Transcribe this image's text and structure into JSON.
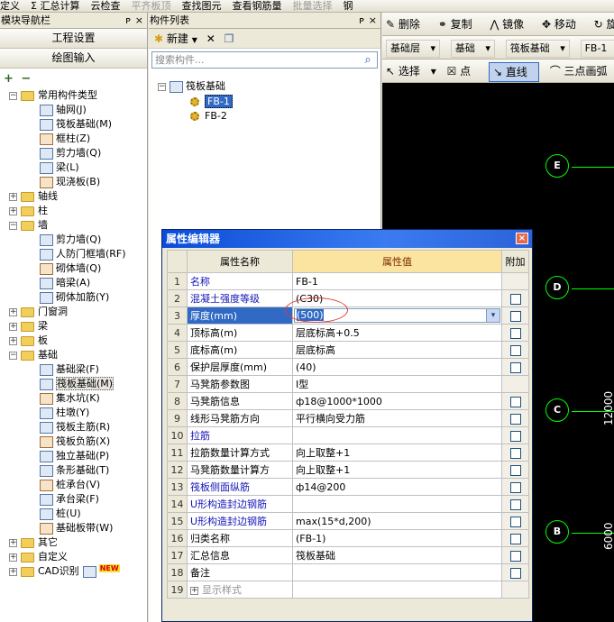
{
  "toolbar": {
    "items": [
      "定义",
      "Σ 汇总计算",
      "云检查",
      "平齐板顶",
      "查找图元",
      "查看钢筋量",
      "批量选择",
      "钢"
    ],
    "disabled": [
      false,
      false,
      false,
      true,
      false,
      false,
      true,
      false
    ]
  },
  "nav": {
    "title": "模块导航栏",
    "pin": "ᴘ",
    "close": "×",
    "btn_project": "工程设置",
    "btn_draw": "绘图输入",
    "tools": "+ −",
    "tree": [
      {
        "label": "常用构件类型",
        "type": "folder",
        "level": 0,
        "exp": "−"
      },
      {
        "label": "轴网(J)",
        "type": "item",
        "level": 1
      },
      {
        "label": "筏板基础(M)",
        "type": "item",
        "level": 1
      },
      {
        "label": "框柱(Z)",
        "type": "item",
        "level": 1
      },
      {
        "label": "剪力墙(Q)",
        "type": "item",
        "level": 1
      },
      {
        "label": "梁(L)",
        "type": "item",
        "level": 1
      },
      {
        "label": "现浇板(B)",
        "type": "item",
        "level": 1
      },
      {
        "label": "轴线",
        "type": "folder",
        "level": 0,
        "exp": "+"
      },
      {
        "label": "柱",
        "type": "folder",
        "level": 0,
        "exp": "+"
      },
      {
        "label": "墙",
        "type": "folder",
        "level": 0,
        "exp": "−"
      },
      {
        "label": "剪力墙(Q)",
        "type": "item",
        "level": 1
      },
      {
        "label": "人防门框墙(RF)",
        "type": "item",
        "level": 1
      },
      {
        "label": "砌体墙(Q)",
        "type": "item",
        "level": 1
      },
      {
        "label": "暗梁(A)",
        "type": "item",
        "level": 1
      },
      {
        "label": "砌体加筋(Y)",
        "type": "item",
        "level": 1
      },
      {
        "label": "门窗洞",
        "type": "folder",
        "level": 0,
        "exp": "+"
      },
      {
        "label": "梁",
        "type": "folder",
        "level": 0,
        "exp": "+"
      },
      {
        "label": "板",
        "type": "folder",
        "level": 0,
        "exp": "+"
      },
      {
        "label": "基础",
        "type": "folder",
        "level": 0,
        "exp": "−"
      },
      {
        "label": "基础梁(F)",
        "type": "item",
        "level": 1
      },
      {
        "label": "筏板基础(M)",
        "type": "item",
        "level": 1,
        "selected": true
      },
      {
        "label": "集水坑(K)",
        "type": "item",
        "level": 1
      },
      {
        "label": "柱墩(Y)",
        "type": "item",
        "level": 1
      },
      {
        "label": "筏板主筋(R)",
        "type": "item",
        "level": 1
      },
      {
        "label": "筏板负筋(X)",
        "type": "item",
        "level": 1
      },
      {
        "label": "独立基础(P)",
        "type": "item",
        "level": 1
      },
      {
        "label": "条形基础(T)",
        "type": "item",
        "level": 1
      },
      {
        "label": "桩承台(V)",
        "type": "item",
        "level": 1
      },
      {
        "label": "承台梁(F)",
        "type": "item",
        "level": 1
      },
      {
        "label": "桩(U)",
        "type": "item",
        "level": 1
      },
      {
        "label": "基础板带(W)",
        "type": "item",
        "level": 1
      },
      {
        "label": "其它",
        "type": "folder",
        "level": 0,
        "exp": "+"
      },
      {
        "label": "自定义",
        "type": "folder",
        "level": 0,
        "exp": "+"
      },
      {
        "label": "CAD识别",
        "type": "folder",
        "level": 0,
        "exp": "+",
        "badge": "NEW"
      }
    ]
  },
  "components": {
    "title": "构件列表",
    "pin": "ᴘ",
    "close": "×",
    "new_label": "新建",
    "delete_icon": "✕",
    "search_placeholder": "搜索构件...",
    "root": "筏板基础",
    "root_exp": "−",
    "items": [
      "FB-1",
      "FB-2"
    ]
  },
  "drawing": {
    "row1": [
      "删除",
      "复制",
      "镜像",
      "移动",
      "旋"
    ],
    "layer_combo": "基础层",
    "floor_combo": "基础",
    "type_combo": "筏板基础",
    "name_combo": "FB-1",
    "row3": [
      "选择",
      "点",
      "直线",
      "三点画弧"
    ],
    "axes": [
      "E",
      "D",
      "C",
      "B"
    ],
    "dims": [
      "12000",
      "6000"
    ]
  },
  "dialog": {
    "title": "属性编辑器",
    "close": "×",
    "col_name": "属性名称",
    "col_value": "属性值",
    "col_attach": "附加",
    "rows": [
      {
        "n": "1",
        "name": "名称",
        "value": "FB-1",
        "blue": true,
        "check": false
      },
      {
        "n": "2",
        "name": "混凝土强度等级",
        "value": "(C30)",
        "blue": true,
        "check": true
      },
      {
        "n": "3",
        "name": "厚度(mm)",
        "value": "(500)",
        "blue": false,
        "check": true,
        "selected": true
      },
      {
        "n": "4",
        "name": "顶标高(m)",
        "value": "层底标高+0.5",
        "blue": false,
        "check": true
      },
      {
        "n": "5",
        "name": "底标高(m)",
        "value": "层底标高",
        "blue": false,
        "check": true
      },
      {
        "n": "6",
        "name": "保护层厚度(mm)",
        "value": "(40)",
        "blue": false,
        "check": true
      },
      {
        "n": "7",
        "name": "马凳筋参数图",
        "value": "I型",
        "blue": false,
        "check": false
      },
      {
        "n": "8",
        "name": "马凳筋信息",
        "value": "ф18@1000*1000",
        "blue": false,
        "check": true
      },
      {
        "n": "9",
        "name": "线形马凳筋方向",
        "value": "平行横向受力筋",
        "blue": false,
        "check": true
      },
      {
        "n": "10",
        "name": "拉筋",
        "value": "",
        "blue": true,
        "check": true
      },
      {
        "n": "11",
        "name": "拉筋数量计算方式",
        "value": "向上取整+1",
        "blue": false,
        "check": true
      },
      {
        "n": "12",
        "name": "马凳筋数量计算方",
        "value": "向上取整+1",
        "blue": false,
        "check": true
      },
      {
        "n": "13",
        "name": "筏板侧面纵筋",
        "value": "ф14@200",
        "blue": true,
        "check": true
      },
      {
        "n": "14",
        "name": "U形构造封边钢筋",
        "value": "",
        "blue": true,
        "check": true
      },
      {
        "n": "15",
        "name": "U形构造封边钢筋",
        "value": "max(15*d,200)",
        "blue": true,
        "check": true
      },
      {
        "n": "16",
        "name": "归类名称",
        "value": "(FB-1)",
        "blue": false,
        "check": true
      },
      {
        "n": "17",
        "name": "汇总信息",
        "value": "筏板基础",
        "blue": false,
        "check": true
      },
      {
        "n": "18",
        "name": "备注",
        "value": "",
        "blue": false,
        "check": true
      },
      {
        "n": "19",
        "name": "显示样式",
        "value": "",
        "blue": false,
        "check": false,
        "expander": "+",
        "gray": true
      }
    ]
  }
}
